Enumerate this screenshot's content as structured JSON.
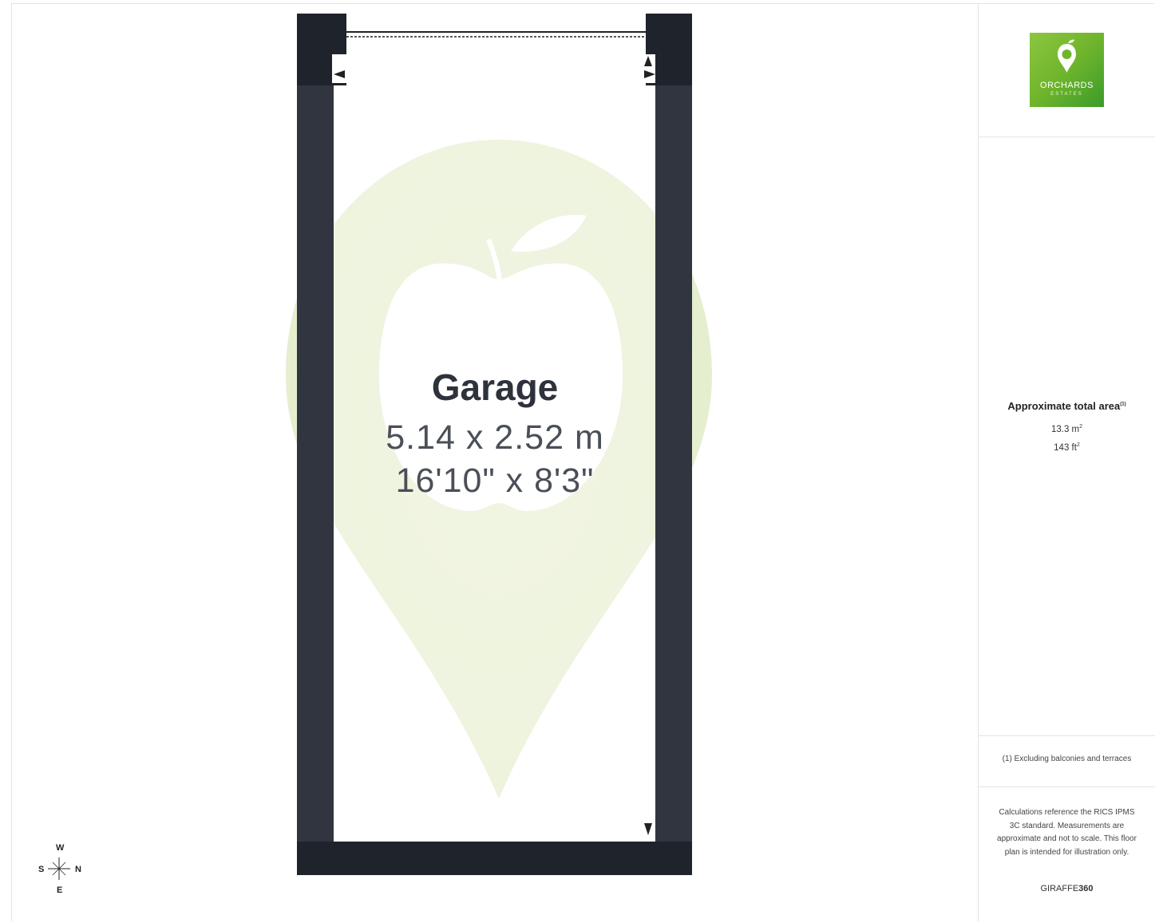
{
  "floor_plan": {
    "room": {
      "name": "Garage",
      "dimensions_metric": "5.14 x 2.52 m",
      "dimensions_imperial": "16'10\" x 8'3\""
    },
    "wall_color": "#30353f",
    "wall_dark_color": "#1f232b",
    "watermark_color": "#e4efcb"
  },
  "compass": {
    "north": "N",
    "south": "S",
    "east": "E",
    "west": "W"
  },
  "sidebar": {
    "logo": {
      "name": "ORCHARDS",
      "subtitle": "ESTATES",
      "icon": "apple-pin-icon",
      "color": "#6fb52c"
    },
    "area_title": "Approximate total area",
    "area_footnote_mark": "(1)",
    "area_m2_value": "13.3 m",
    "area_ft2_value": "143 ft",
    "unit_exponent": "2",
    "footnote": "(1) Excluding balconies and terraces",
    "disclaimer": "Calculations reference the RICS IPMS 3C standard. Measurements are approximate and not to scale. This floor plan is intended for illustration only.",
    "brand_prefix": "GIRAFFE",
    "brand_suffix": "360"
  }
}
